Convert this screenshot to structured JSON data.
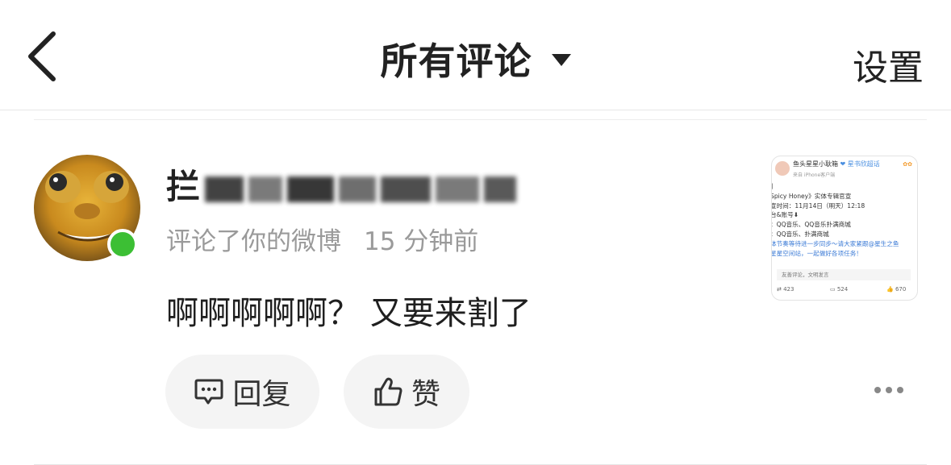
{
  "header": {
    "title": "所有评论",
    "settings_label": "设置"
  },
  "notification": {
    "username_visible": "拦",
    "action": "评论了你的微博",
    "time": "15 分钟前",
    "comment_text": "啊啊啊啊啊？ 又要来割了",
    "reply_label": "回复",
    "like_label": "赞",
    "online_color": "#3cbf34"
  },
  "thumbnail": {
    "author": "鱼头星星小耿箱",
    "tag": "❤ 星书欣超话",
    "source": "来自 iPhone客户端",
    "lines": [
      "】",
      "Spicy Honey》实体专辑官宣",
      "宣时间：11月14日（明天）12:18",
      "台&账号⬇",
      "：QQ音乐、QQ音乐扑满商城",
      "：QQ音乐、扑满商城",
      "体节奏等待进一步同步～请大家紧跟@星生之鱼",
      "星星空间站，一起做好各项任务！"
    ],
    "comment_hint": "友善评论，文明发言",
    "reposts": "423",
    "comments": "524",
    "likes": "670"
  }
}
